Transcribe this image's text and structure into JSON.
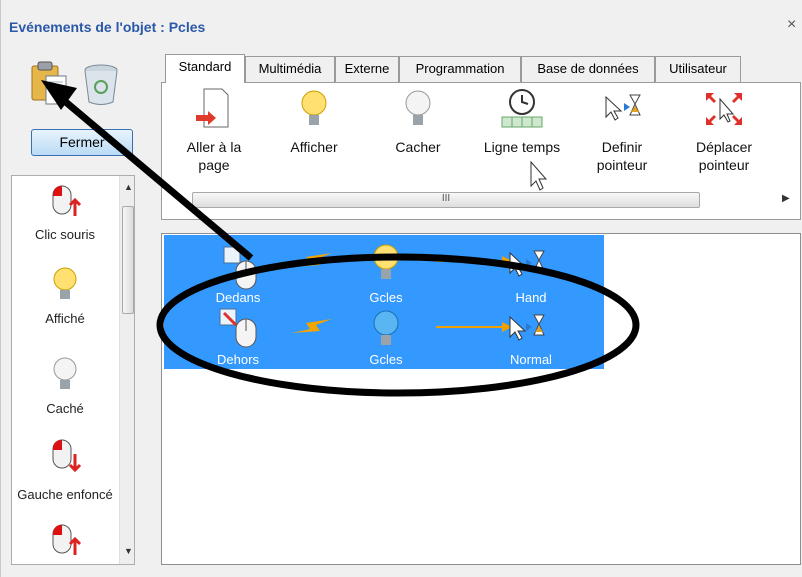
{
  "window": {
    "title": "Evénements de l'objet : Pcles",
    "close_glyph": "×"
  },
  "toolbar": {
    "paste_icon": "clipboard-paste-icon",
    "delete_icon": "recycle-bin-icon",
    "close_label": "Fermer"
  },
  "events": {
    "items": [
      {
        "label": "Clic souris",
        "icon": "mouse-click-icon"
      },
      {
        "label": "Affiché",
        "icon": "bulb-on-icon"
      },
      {
        "label": "Caché",
        "icon": "bulb-off-icon"
      },
      {
        "label": "Gauche enfoncé",
        "icon": "mouse-left-down-icon"
      },
      {
        "label": "",
        "icon": "mouse-left-up-icon"
      }
    ]
  },
  "tabs": [
    {
      "label": "Standard",
      "active": true
    },
    {
      "label": "Multimédia",
      "active": false
    },
    {
      "label": "Externe",
      "active": false
    },
    {
      "label": "Programmation",
      "active": false
    },
    {
      "label": "Base de données",
      "active": false
    },
    {
      "label": "Utilisateur",
      "active": false
    }
  ],
  "actions": [
    {
      "label_line1": "Aller à la",
      "label_line2": "page",
      "icon": "goto-page-icon"
    },
    {
      "label_line1": "Afficher",
      "label_line2": "",
      "icon": "bulb-on-icon"
    },
    {
      "label_line1": "Cacher",
      "label_line2": "",
      "icon": "bulb-off-icon"
    },
    {
      "label_line1": "Ligne temps",
      "label_line2": "",
      "icon": "timeline-clock-icon"
    },
    {
      "label_line1": "Definir",
      "label_line2": "pointeur",
      "icon": "cursor-hourglass-icon"
    },
    {
      "label_line1": "Déplacer",
      "label_line2": "pointeur",
      "icon": "move-arrows-icon"
    }
  ],
  "hscroll": {
    "thumb_grip": "III"
  },
  "rules": [
    {
      "trigger": "Dedans",
      "target": "Gcles",
      "result": "Hand"
    },
    {
      "trigger": "Dehors",
      "target": "Gcles",
      "result": "Normal"
    }
  ],
  "colors": {
    "selection": "#3399ff",
    "title": "#2b58a8",
    "arrow": "#f0a000"
  }
}
